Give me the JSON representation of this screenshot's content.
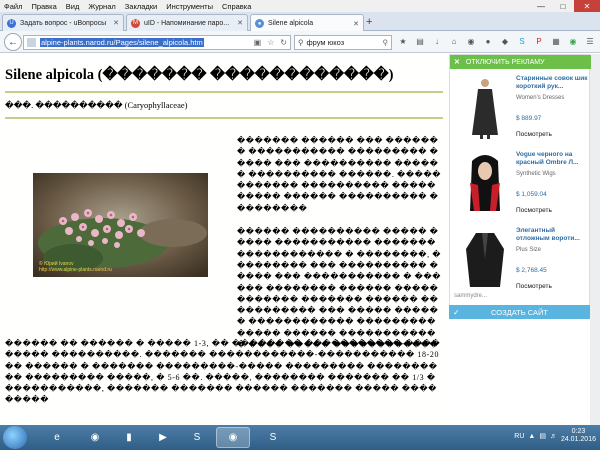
{
  "menu": [
    "Файл",
    "Правка",
    "Вид",
    "Журнал",
    "Закладки",
    "Инструменты",
    "Справка"
  ],
  "tabs": [
    {
      "label": "Задать вопрос - uВопросы",
      "icon": "uvoprosy-icon",
      "color": "#3a70d8"
    },
    {
      "label": "uID - Напоминание паро...",
      "icon": "gmail-icon",
      "color": "#d14836"
    },
    {
      "label": "Silene alpicola",
      "icon": "firefox-page-icon",
      "color": "#5a8fd0"
    }
  ],
  "address": {
    "url": "alpine-plants.narod.ru/Pages/silene_alpicola.htm"
  },
  "search": {
    "value": "фрум юкоз"
  },
  "page": {
    "title": "Silene alpicola (������� ������������)",
    "family": "���. ���������� (Caryophyllaceae)",
    "watermark_line1": "© Юрий Ivanov",
    "watermark_line2": "http://www.alpine-plants.narod.ru",
    "right_para_1": "������� ������ ��� ������� ����������� ��������� ����� ��� ���������� ������ ���������� ������. ������������ ���������� ���������� ������ ���������� ���������",
    "right_para_2": "������ ���������� ����� ����� ����������� ������� ������������ � ��������, ��������� ��� ���������� ����� ��� ����������� � ������ �������� ������ ������������ ������� ������ ����������� ��� ����� ������ ������������ ��������� ����� ������ ������������ ���� ����� ������������",
    "bottom_para": "������ �� ������ � ����� 1-3, �� �������� �����������-��������� ����������. ������� ������������-����������� 18-20 �� ������ � ������� ���������-����� ��������� ���������� ��������� �����, � 5-6 ��. �����, �������� ������� �� 1/3 ������������, ������� ������� ������ ������� ����� ���������"
  },
  "ad": {
    "disable_label": "ОТКЛЮЧИТЬ РЕКЛАМУ",
    "items": [
      {
        "title": "Старинные совок шик короткий рук...",
        "category": "Women's Dresses",
        "price": "$ 889.97",
        "action": "Посмотреть"
      },
      {
        "title": "Vogue черного на красный Ombre Л...",
        "category": "Synthetic Wigs",
        "price": "$ 1,059.04",
        "action": "Посмотреть"
      },
      {
        "title": "Элегантный отложным вороти...",
        "category": "Plus Size",
        "price": "$ 2,768.45",
        "action": "Посмотреть"
      }
    ],
    "footer": "sammydre...",
    "create_label": "СОЗДАТЬ САЙТ"
  },
  "taskbar": {
    "lang": "RU",
    "time": "0:23",
    "date": "24.01.2016"
  }
}
